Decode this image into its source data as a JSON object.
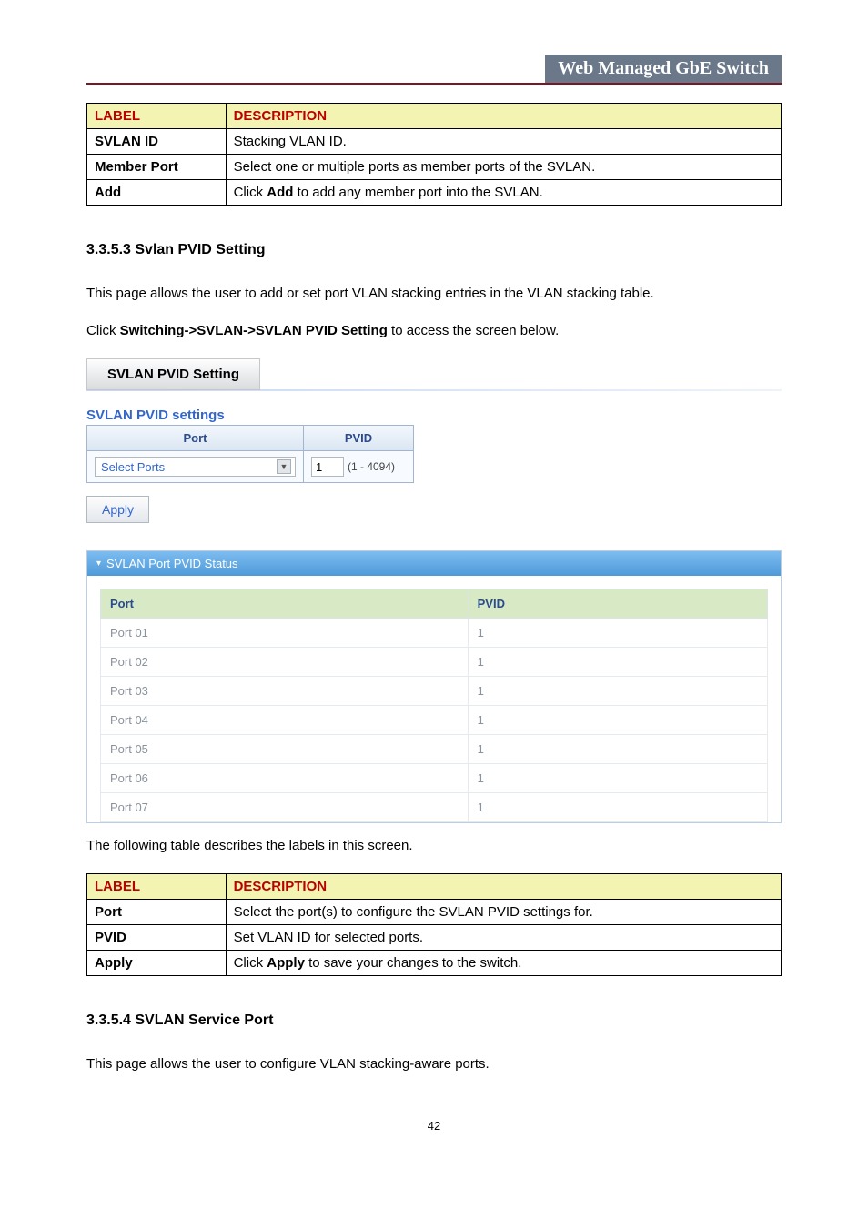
{
  "header": {
    "title": "Web Managed GbE Switch"
  },
  "table1": {
    "head_label": "LABEL",
    "head_desc": "DESCRIPTION",
    "rows": [
      {
        "label": "SVLAN ID",
        "desc": "Stacking VLAN ID."
      },
      {
        "label": "Member Port",
        "desc": "Select one or multiple ports as member ports of the SVLAN."
      },
      {
        "label": "Add",
        "desc_pre": "Click ",
        "desc_bold": "Add",
        "desc_post": " to add any member port into the SVLAN."
      }
    ]
  },
  "section1": {
    "heading": "3.3.5.3 Svlan PVID Setting",
    "p1": "This page allows the user to add or set port VLAN stacking entries in the VLAN stacking table.",
    "p2_pre": "Click ",
    "p2_bold": "Switching->SVLAN->SVLAN PVID Setting",
    "p2_post": " to access the screen below."
  },
  "tab": {
    "label": "SVLAN PVID Setting"
  },
  "settings": {
    "title": "SVLAN PVID settings",
    "port_header": "Port",
    "pvid_header": "PVID",
    "select_placeholder": "Select Ports",
    "pvid_value": "1",
    "pvid_hint": "(1 - 4094)",
    "apply_label": "Apply"
  },
  "status": {
    "title": "SVLAN Port PVID Status",
    "port_header": "Port",
    "pvid_header": "PVID",
    "rows": [
      {
        "port": "Port 01",
        "pvid": "1"
      },
      {
        "port": "Port 02",
        "pvid": "1"
      },
      {
        "port": "Port 03",
        "pvid": "1"
      },
      {
        "port": "Port 04",
        "pvid": "1"
      },
      {
        "port": "Port 05",
        "pvid": "1"
      },
      {
        "port": "Port 06",
        "pvid": "1"
      },
      {
        "port": "Port 07",
        "pvid": "1"
      }
    ]
  },
  "table2_intro": "The following table describes the labels in this screen.",
  "table2": {
    "head_label": "LABEL",
    "head_desc": "DESCRIPTION",
    "rows": [
      {
        "label": "Port",
        "desc": "Select the port(s) to configure the SVLAN PVID settings for."
      },
      {
        "label": "PVID",
        "desc": "Set VLAN ID for selected ports."
      },
      {
        "label": "Apply",
        "desc_pre": "Click ",
        "desc_bold": "Apply",
        "desc_post": " to save your changes to the switch."
      }
    ]
  },
  "section2": {
    "heading": "3.3.5.4 SVLAN Service Port",
    "p1": "This page allows the user to configure VLAN stacking-aware ports."
  },
  "page_number": "42"
}
